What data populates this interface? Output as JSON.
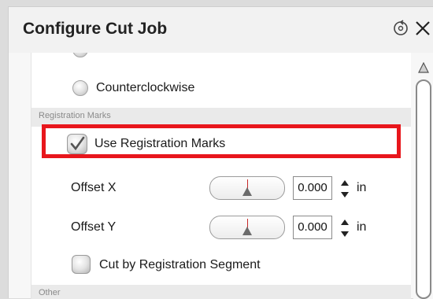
{
  "window": {
    "title": "Configure Cut Job"
  },
  "direction": {
    "option_label": "Counterclockwise"
  },
  "registration": {
    "section_label": "Registration Marks",
    "use_marks_label": "Use Registration Marks",
    "use_marks_checked": true,
    "offset_x": {
      "label": "Offset X",
      "value": "0.000",
      "unit": "in"
    },
    "offset_y": {
      "label": "Offset Y",
      "value": "0.000",
      "unit": "in"
    },
    "cut_by_segment_label": "Cut by Registration Segment",
    "cut_by_segment_checked": false
  },
  "other": {
    "section_label": "Other"
  },
  "colors": {
    "highlight": "#e8161c"
  }
}
